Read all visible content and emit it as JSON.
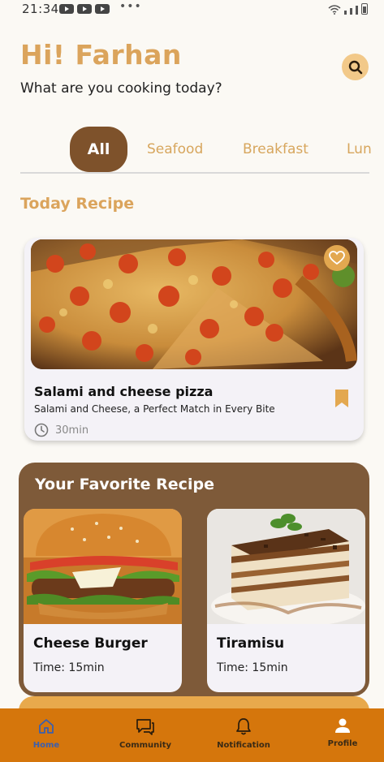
{
  "status": {
    "time": "21:34",
    "dots": "•••"
  },
  "header": {
    "greeting": "Hi! Farhan",
    "subtitle": "What are you cooking today?"
  },
  "categories": [
    {
      "label": "All",
      "active": true
    },
    {
      "label": "Seafood"
    },
    {
      "label": "Breakfast"
    },
    {
      "label": "Lun"
    }
  ],
  "today": {
    "section_title": "Today Recipe",
    "name": "Salami and cheese pizza",
    "description": "Salami and Cheese, a Perfect Match in Every Bite",
    "time": "30min"
  },
  "favorites": {
    "section_title": "Your Favorite Recipe",
    "items": [
      {
        "name": "Cheese Burger",
        "time": "Time: 15min"
      },
      {
        "name": "Tiramisu",
        "time": "Time: 15min"
      }
    ]
  },
  "nav": [
    {
      "label": "Home",
      "icon": "home-icon",
      "active": true
    },
    {
      "label": "Community",
      "icon": "chat-icon"
    },
    {
      "label": "Notification",
      "icon": "bell-icon"
    },
    {
      "label": "Profile",
      "icon": "person-icon"
    }
  ],
  "colors": {
    "accent": "#dba45c",
    "brown": "#7e522b",
    "nav_bg": "#d5760c",
    "active_nav": "#3b5fae"
  }
}
